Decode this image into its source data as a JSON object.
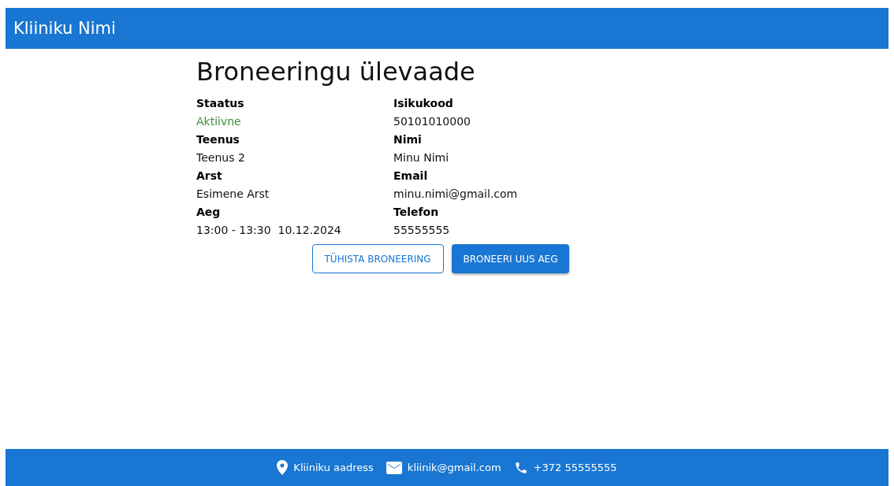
{
  "header": {
    "title": "Kliiniku Nimi"
  },
  "page": {
    "title": "Broneeringu ülevaade"
  },
  "columns": [
    [
      {
        "label": "Staatus",
        "value": "Aktiivne",
        "color": "#3f8f3a"
      },
      {
        "label": "Teenus",
        "value": "Teenus 2"
      },
      {
        "label": "Arst",
        "value": "Esimene Arst"
      },
      {
        "label": "Aeg",
        "value": "13:00 - 13:30  10.12.2024"
      }
    ],
    [
      {
        "label": "Isikukood",
        "value": "50101010000"
      },
      {
        "label": "Nimi",
        "value": "Minu Nimi"
      },
      {
        "label": "Email",
        "value": "minu.nimi@gmail.com"
      },
      {
        "label": "Telefon",
        "value": "55555555"
      }
    ]
  ],
  "buttons": [
    {
      "label": "TÜHISTA BRONEERING",
      "kind": "outlined"
    },
    {
      "label": "BRONEERI UUS AEG",
      "kind": "contained"
    }
  ],
  "footer": [
    {
      "kind": "location",
      "text": "Kliiniku aadress"
    },
    {
      "kind": "email",
      "text": "kliinik@gmail.com"
    },
    {
      "kind": "phone",
      "text": "+372 55555555"
    }
  ]
}
